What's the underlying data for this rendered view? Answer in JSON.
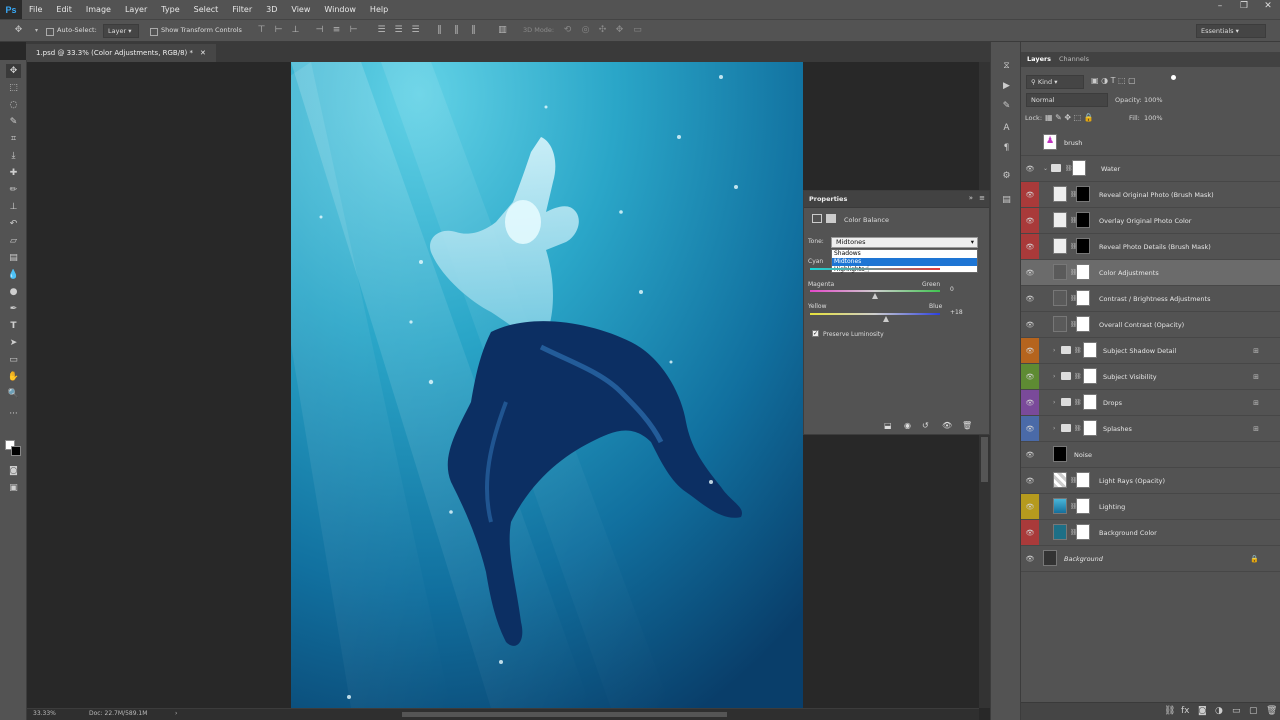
{
  "app": {
    "logo": "Ps"
  },
  "menu": [
    "File",
    "Edit",
    "Image",
    "Layer",
    "Type",
    "Select",
    "Filter",
    "3D",
    "View",
    "Window",
    "Help"
  ],
  "window_controls": [
    "–",
    "❐",
    "✕"
  ],
  "options": {
    "auto_select": "Auto-Select:",
    "auto_select_target": "Layer",
    "transform_controls": "Show Transform Controls",
    "mode_3d": "3D Mode:",
    "workspace": "Essentials"
  },
  "document": {
    "tab": "1.psd @ 33.3% (Color Adjustments, RGB/8) *",
    "zoom": "33.33%",
    "doc_size": "Doc: 22.7M/589.1M"
  },
  "properties": {
    "title": "Properties",
    "adjustment": "Color Balance",
    "tone_label": "Tone:",
    "tone_value": "Midtones",
    "tone_options": [
      "Shadows",
      "Midtones",
      "Highlights"
    ],
    "sliders": [
      {
        "left": "Cyan",
        "right": "",
        "value": "",
        "level": 0.5
      },
      {
        "left": "Magenta",
        "right": "Green",
        "value": "0",
        "level": 0.5
      },
      {
        "left": "Yellow",
        "right": "Blue",
        "value": "+18",
        "level": 0.59
      }
    ],
    "preserve_luminosity": "Preserve Luminosity",
    "preserve_checked": true
  },
  "layers_panel": {
    "tabs": [
      "Layers",
      "Channels"
    ],
    "filter": "Kind",
    "blend_mode": "Normal",
    "opacity_label": "Opacity:",
    "opacity": "100%",
    "lock_label": "Lock:",
    "fill_label": "Fill:",
    "fill": "100%",
    "layers": [
      {
        "name": "brush",
        "visible": false,
        "color": "",
        "kind": "pixel"
      },
      {
        "name": "Water",
        "visible": true,
        "color": "",
        "kind": "group"
      },
      {
        "name": "Reveal Original Photo (Brush Mask)",
        "visible": true,
        "color": "#a93a3a",
        "kind": "smart"
      },
      {
        "name": "Overlay Original Photo Color",
        "visible": true,
        "color": "#a93a3a",
        "kind": "smart"
      },
      {
        "name": "Reveal Photo Details (Brush Mask)",
        "visible": true,
        "color": "#a93a3a",
        "kind": "smart"
      },
      {
        "name": "Color Adjustments",
        "visible": true,
        "color": "",
        "kind": "adjust",
        "selected": true
      },
      {
        "name": "Contrast / Brightness Adjustments",
        "visible": true,
        "color": "",
        "kind": "adjust"
      },
      {
        "name": "Overall Contrast (Opacity)",
        "visible": true,
        "color": "",
        "kind": "adjust"
      },
      {
        "name": "Subject Shadow Detail",
        "visible": true,
        "color": "#b5641e",
        "kind": "group"
      },
      {
        "name": "Subject Visibility",
        "visible": true,
        "color": "#5e8b33",
        "kind": "group"
      },
      {
        "name": "Drops",
        "visible": true,
        "color": "#7a4a9a",
        "kind": "group"
      },
      {
        "name": "Splashes",
        "visible": true,
        "color": "#4a6aa8",
        "kind": "group"
      },
      {
        "name": "Noise",
        "visible": true,
        "color": "",
        "kind": "black"
      },
      {
        "name": "Light Rays (Opacity)",
        "visible": true,
        "color": "",
        "kind": "checker"
      },
      {
        "name": "Lighting",
        "visible": true,
        "color": "#b59a1e",
        "kind": "photo"
      },
      {
        "name": "Background Color",
        "visible": true,
        "color": "#a93a3a",
        "kind": "teal"
      },
      {
        "name": "Background",
        "visible": true,
        "color": "",
        "kind": "bg"
      }
    ]
  },
  "colors": {
    "selection": "#1e75d4",
    "canvas_bg": "#282828",
    "panel": "#535353"
  }
}
